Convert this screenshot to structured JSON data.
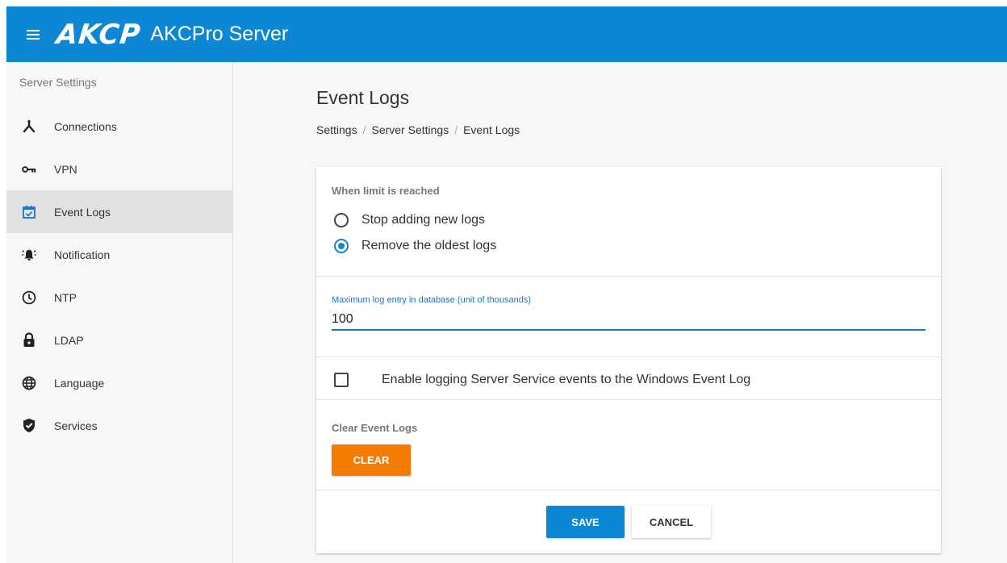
{
  "header": {
    "menu_icon": "hamburger-icon",
    "logo_text": "AKCP",
    "app_title": "AKCPro Server",
    "bg_color": "#0d86d3"
  },
  "sidebar": {
    "header": "Server Settings",
    "items": [
      {
        "label": "Connections",
        "icon": "connections-icon",
        "active": false
      },
      {
        "label": "VPN",
        "icon": "key-icon",
        "active": false
      },
      {
        "label": "Event Logs",
        "icon": "calendar-check-icon",
        "active": true
      },
      {
        "label": "Notification",
        "icon": "bell-ring-icon",
        "active": false
      },
      {
        "label": "NTP",
        "icon": "clock-icon",
        "active": false
      },
      {
        "label": "LDAP",
        "icon": "lock-icon",
        "active": false
      },
      {
        "label": "Language",
        "icon": "globe-icon",
        "active": false
      },
      {
        "label": "Services",
        "icon": "shield-check-icon",
        "active": false
      }
    ]
  },
  "page": {
    "title": "Event Logs",
    "breadcrumb": [
      "Settings",
      "Server Settings",
      "Event Logs"
    ],
    "limit_section": {
      "label": "When limit is reached",
      "options": [
        {
          "label": "Stop adding new logs",
          "checked": false
        },
        {
          "label": "Remove the oldest logs",
          "checked": true
        }
      ]
    },
    "max_log": {
      "label": "Maximum log entry in database (unit of thousands)",
      "value": "100"
    },
    "windows_log": {
      "label": "Enable logging Server Service events to the Windows Event Log",
      "checked": false
    },
    "clear_section": {
      "label": "Clear Event Logs",
      "button": "CLEAR",
      "button_color": "#f57c00"
    },
    "actions": {
      "save": "SAVE",
      "cancel": "CANCEL"
    }
  }
}
